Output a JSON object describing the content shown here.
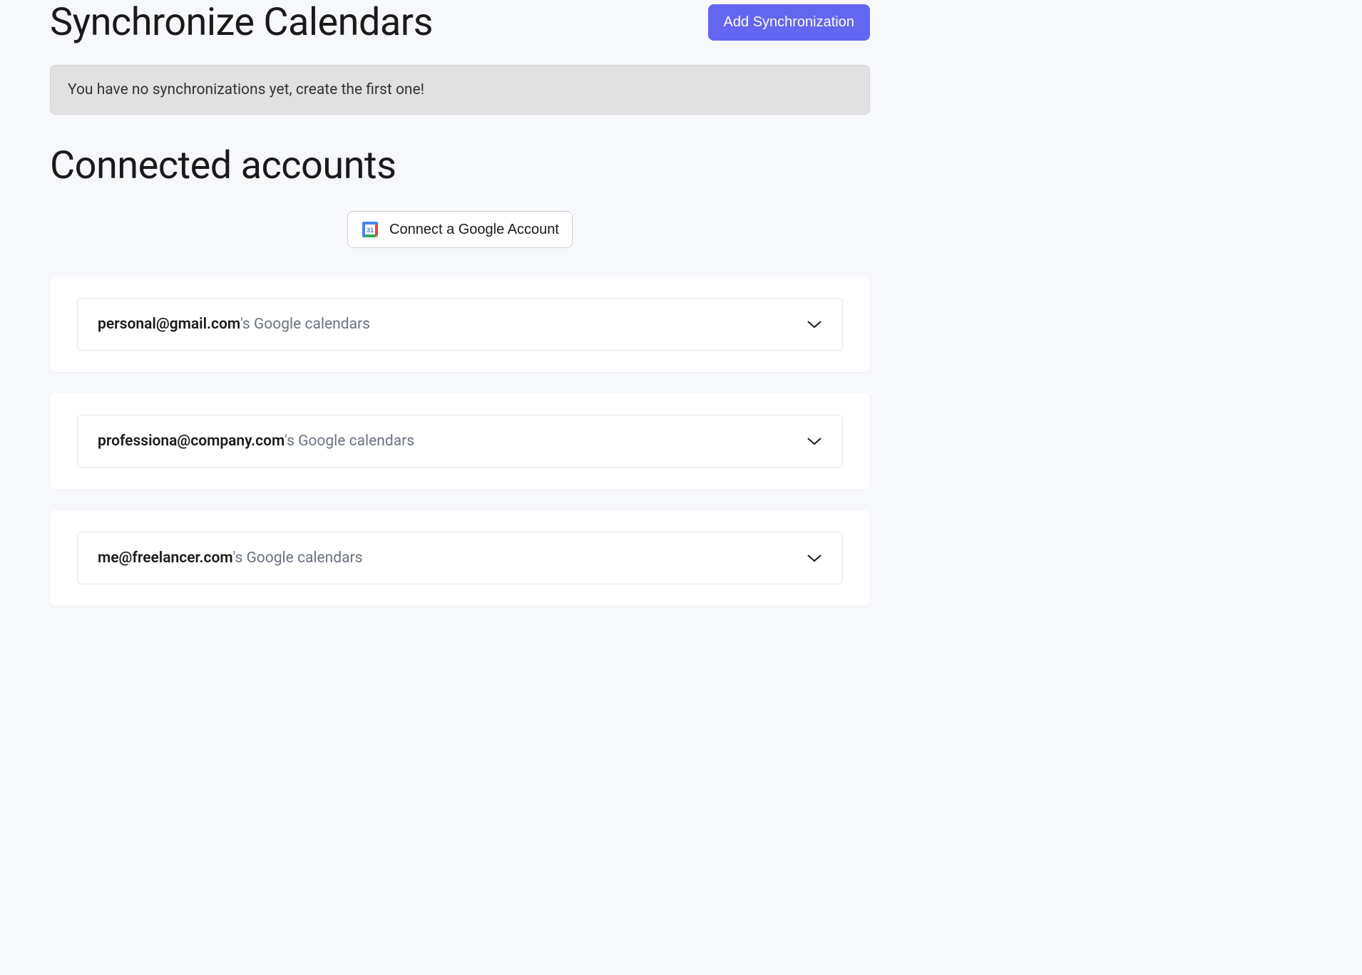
{
  "header": {
    "title": "Synchronize Calendars",
    "add_button_label": "Add Synchronization"
  },
  "banner": {
    "message": "You have no synchronizations yet, create the first one!"
  },
  "connected": {
    "title": "Connected accounts",
    "connect_button_label": "Connect a Google Account",
    "account_suffix": "'s Google calendars",
    "accounts": [
      {
        "email": "personal@gmail.com"
      },
      {
        "email": "professiona@company.com"
      },
      {
        "email": "me@freelancer.com"
      }
    ]
  }
}
